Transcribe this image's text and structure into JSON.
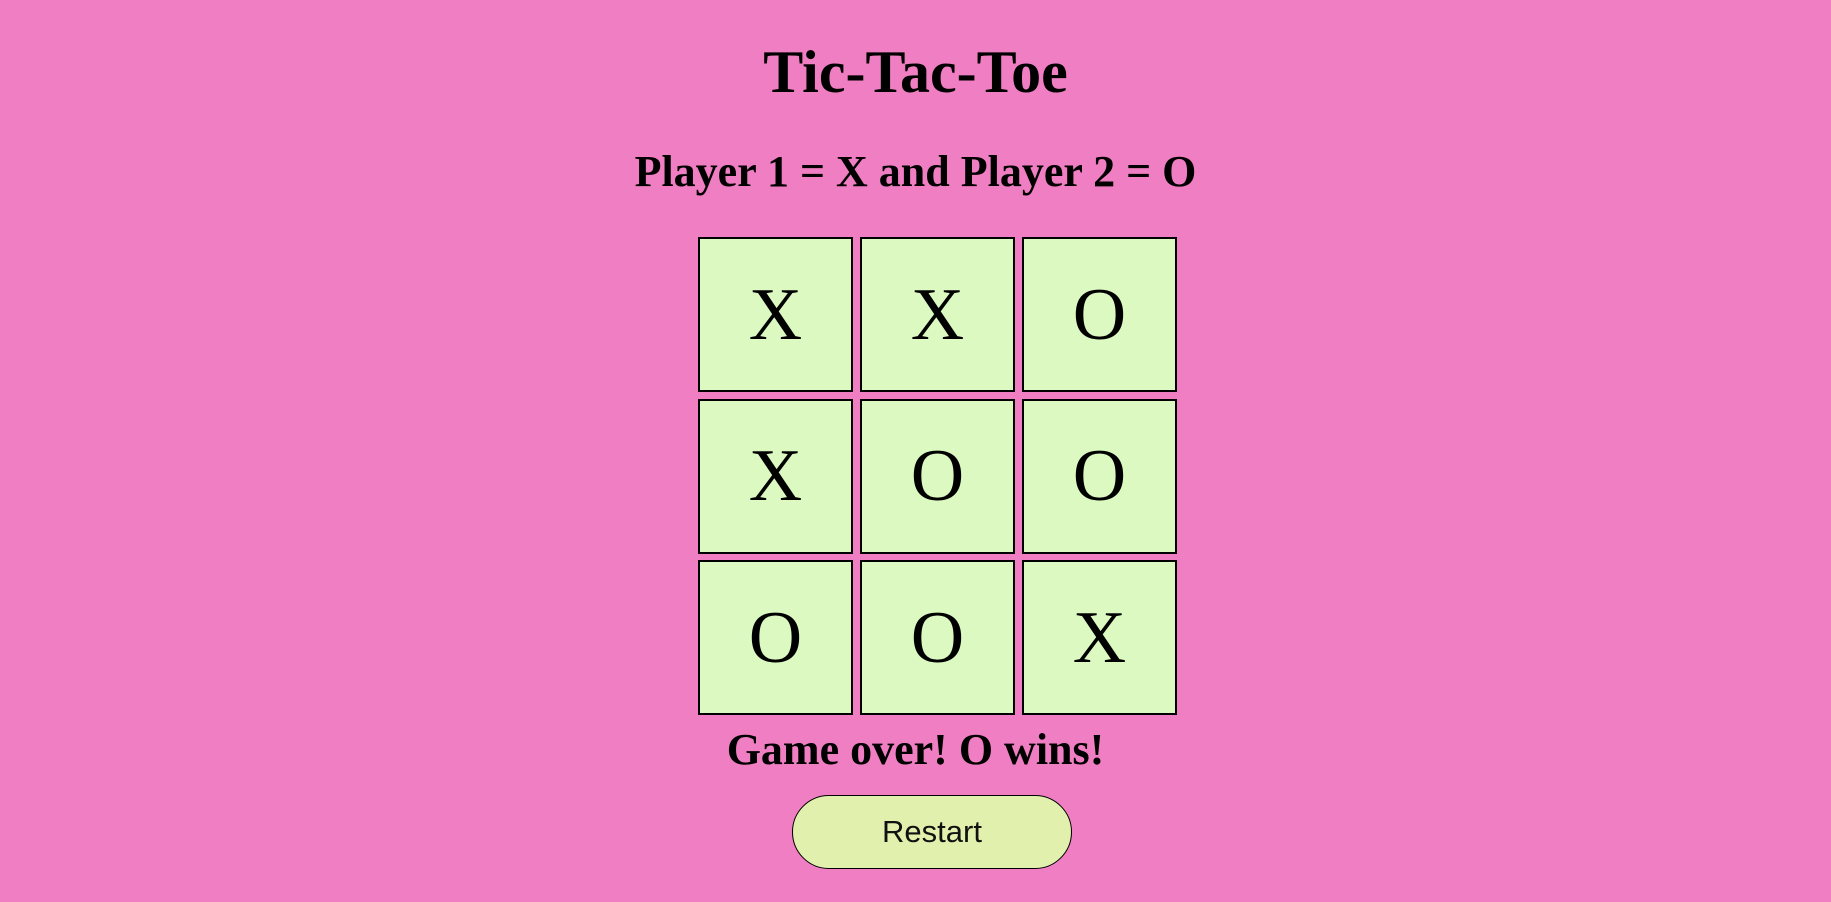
{
  "game": {
    "title": "Tic-Tac-Toe",
    "subtitle": "Player 1 = X and Player 2 = O",
    "board": [
      [
        "X",
        "X",
        "O"
      ],
      [
        "X",
        "O",
        "O"
      ],
      [
        "O",
        "O",
        "X"
      ]
    ],
    "status": "Game over! O wins!",
    "restart_label": "Restart"
  },
  "colors": {
    "background": "#f07ec2",
    "cell": "#dbf9c0",
    "button": "#e1f0ad",
    "text": "#000000"
  }
}
